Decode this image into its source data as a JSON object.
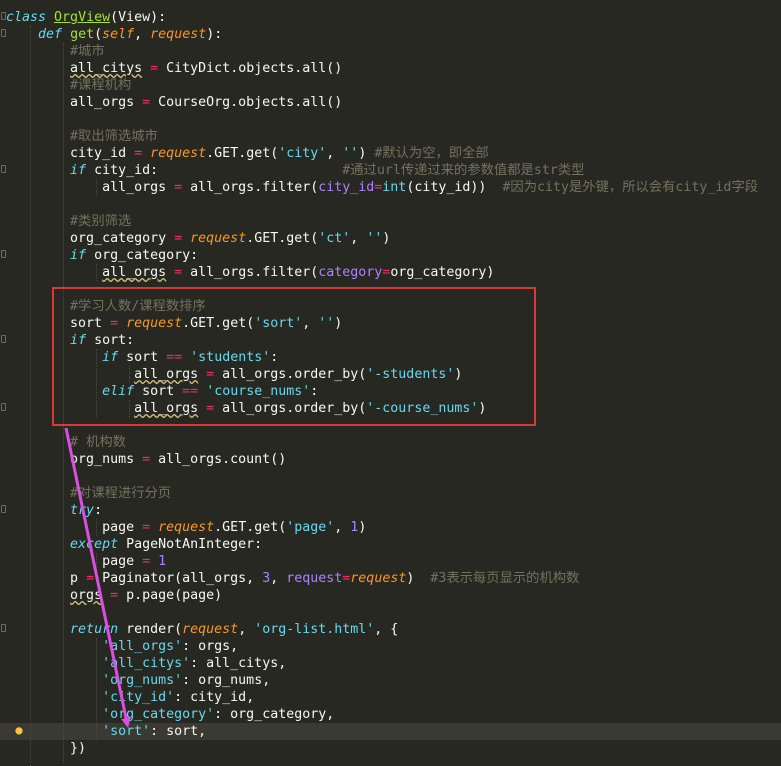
{
  "editor": {
    "lines": [
      [
        [
          "kw",
          "class"
        ],
        [
          "",
          " "
        ],
        [
          "cls",
          "OrgView"
        ],
        [
          "",
          "(View):"
        ]
      ],
      [
        [
          "",
          "    "
        ],
        [
          "kw",
          "def"
        ],
        [
          "",
          " "
        ],
        [
          "fn",
          "get"
        ],
        [
          "",
          "("
        ],
        [
          "self",
          "self"
        ],
        [
          "",
          ", "
        ],
        [
          "param",
          "request"
        ],
        [
          "",
          "):"
        ]
      ],
      [
        [
          "",
          "        "
        ],
        [
          "com",
          "#城市"
        ]
      ],
      [
        [
          "",
          "        "
        ],
        [
          "warn",
          "all_citys"
        ],
        [
          "",
          " "
        ],
        [
          "op",
          "="
        ],
        [
          "",
          " CityDict.objects.all()"
        ]
      ],
      [
        [
          "",
          "        "
        ],
        [
          "com",
          "#课程机构"
        ]
      ],
      [
        [
          "",
          "        all_orgs "
        ],
        [
          "op",
          "="
        ],
        [
          "",
          " CourseOrg.objects.all()"
        ]
      ],
      [],
      [
        [
          "",
          "        "
        ],
        [
          "com",
          "#取出筛选城市"
        ]
      ],
      [
        [
          "",
          "        city_id "
        ],
        [
          "op",
          "="
        ],
        [
          "",
          " "
        ],
        [
          "param",
          "request"
        ],
        [
          "",
          ".GET.get("
        ],
        [
          "str",
          "'city'"
        ],
        [
          "",
          ", "
        ],
        [
          "str",
          "''"
        ],
        [
          "",
          ") "
        ],
        [
          "com",
          "#默认为空，即全部"
        ]
      ],
      [
        [
          "",
          "        "
        ],
        [
          "kw",
          "if"
        ],
        [
          "",
          " city_id:                       "
        ],
        [
          "com",
          "#通过url传递过来的参数值都是str类型"
        ]
      ],
      [
        [
          "",
          "            all_orgs "
        ],
        [
          "op",
          "="
        ],
        [
          "",
          " all_orgs.filter("
        ],
        [
          "kwarg",
          "city_id"
        ],
        [
          "op",
          "="
        ],
        [
          "builtin",
          "int"
        ],
        [
          "",
          "(city_id))  "
        ],
        [
          "com",
          "#因为city是外键，所以会有city_id字段"
        ]
      ],
      [],
      [
        [
          "",
          "        "
        ],
        [
          "com",
          "#类别筛选"
        ]
      ],
      [
        [
          "",
          "        org_category "
        ],
        [
          "op",
          "="
        ],
        [
          "",
          " "
        ],
        [
          "param",
          "request"
        ],
        [
          "",
          ".GET.get("
        ],
        [
          "str",
          "'ct'"
        ],
        [
          "",
          ", "
        ],
        [
          "str",
          "''"
        ],
        [
          "",
          ")"
        ]
      ],
      [
        [
          "",
          "        "
        ],
        [
          "kw",
          "if"
        ],
        [
          "",
          " org_category:"
        ]
      ],
      [
        [
          "",
          "            "
        ],
        [
          "warn",
          "all_orgs"
        ],
        [
          "",
          " "
        ],
        [
          "op",
          "="
        ],
        [
          "",
          " all_orgs.filter("
        ],
        [
          "kwarg",
          "category"
        ],
        [
          "op",
          "="
        ],
        [
          "",
          "org_category)"
        ]
      ],
      [],
      [
        [
          "",
          "        "
        ],
        [
          "com",
          "#学习人数/课程数排序"
        ]
      ],
      [
        [
          "",
          "        sort "
        ],
        [
          "op",
          "="
        ],
        [
          "",
          " "
        ],
        [
          "param",
          "request"
        ],
        [
          "",
          ".GET.get("
        ],
        [
          "str",
          "'sort'"
        ],
        [
          "",
          ", "
        ],
        [
          "str",
          "''"
        ],
        [
          "",
          ")"
        ]
      ],
      [
        [
          "",
          "        "
        ],
        [
          "kw",
          "if"
        ],
        [
          "",
          " sort:"
        ]
      ],
      [
        [
          "",
          "            "
        ],
        [
          "kw",
          "if"
        ],
        [
          "",
          " sort "
        ],
        [
          "op",
          "=="
        ],
        [
          "",
          " "
        ],
        [
          "str",
          "'students'"
        ],
        [
          "",
          ":"
        ]
      ],
      [
        [
          "",
          "                "
        ],
        [
          "warn",
          "all_orgs"
        ],
        [
          "",
          " "
        ],
        [
          "op",
          "="
        ],
        [
          "",
          " all_orgs.order_by("
        ],
        [
          "str",
          "'-students'"
        ],
        [
          "",
          ")"
        ]
      ],
      [
        [
          "",
          "            "
        ],
        [
          "kw",
          "elif"
        ],
        [
          "",
          " sort "
        ],
        [
          "op",
          "=="
        ],
        [
          "",
          " "
        ],
        [
          "str",
          "'course_nums'"
        ],
        [
          "",
          ":"
        ]
      ],
      [
        [
          "",
          "                "
        ],
        [
          "warn",
          "all_orgs"
        ],
        [
          "",
          " "
        ],
        [
          "op",
          "="
        ],
        [
          "",
          " all_orgs.order_by("
        ],
        [
          "str",
          "'-course_nums'"
        ],
        [
          "",
          ")"
        ]
      ],
      [],
      [
        [
          "",
          "        "
        ],
        [
          "com",
          "# 机构数"
        ]
      ],
      [
        [
          "",
          "        org_nums "
        ],
        [
          "op",
          "="
        ],
        [
          "",
          " all_orgs.count()"
        ]
      ],
      [],
      [
        [
          "",
          "        "
        ],
        [
          "com",
          "#对课程进行分页"
        ]
      ],
      [
        [
          "",
          "        "
        ],
        [
          "kw",
          "try"
        ],
        [
          "",
          ":"
        ]
      ],
      [
        [
          "",
          "            page "
        ],
        [
          "op",
          "="
        ],
        [
          "",
          " "
        ],
        [
          "param",
          "request"
        ],
        [
          "",
          ".GET.get("
        ],
        [
          "str",
          "'page'"
        ],
        [
          "",
          ", "
        ],
        [
          "num",
          "1"
        ],
        [
          "",
          ")"
        ]
      ],
      [
        [
          "",
          "        "
        ],
        [
          "kw",
          "except"
        ],
        [
          "",
          " PageNotAnInteger:"
        ]
      ],
      [
        [
          "",
          "            page "
        ],
        [
          "op",
          "="
        ],
        [
          "",
          " "
        ],
        [
          "num",
          "1"
        ]
      ],
      [
        [
          "",
          "        p "
        ],
        [
          "op",
          "="
        ],
        [
          "",
          " Paginator(all_orgs, "
        ],
        [
          "num",
          "3"
        ],
        [
          "",
          ", "
        ],
        [
          "kwarg",
          "request"
        ],
        [
          "op",
          "="
        ],
        [
          "param",
          "request"
        ],
        [
          "",
          ")  "
        ],
        [
          "com",
          "#3表示每页显示的机构数"
        ]
      ],
      [
        [
          "",
          "        "
        ],
        [
          "warn",
          "orgs"
        ],
        [
          "",
          " "
        ],
        [
          "op",
          "="
        ],
        [
          "",
          " p.page(page)"
        ]
      ],
      [],
      [
        [
          "",
          "        "
        ],
        [
          "kw",
          "return"
        ],
        [
          "",
          " render("
        ],
        [
          "param",
          "request"
        ],
        [
          "",
          ", "
        ],
        [
          "str",
          "'org-list.html'"
        ],
        [
          "",
          ", {"
        ]
      ],
      [
        [
          "",
          "            "
        ],
        [
          "str",
          "'all_orgs'"
        ],
        [
          "",
          ": orgs,"
        ]
      ],
      [
        [
          "",
          "            "
        ],
        [
          "str",
          "'all_citys'"
        ],
        [
          "",
          ": all_citys,"
        ]
      ],
      [
        [
          "",
          "            "
        ],
        [
          "str",
          "'org_nums'"
        ],
        [
          "",
          ": org_nums,"
        ]
      ],
      [
        [
          "",
          "            "
        ],
        [
          "str",
          "'city_id'"
        ],
        [
          "",
          ": city_id,"
        ]
      ],
      [
        [
          "",
          "            "
        ],
        [
          "str",
          "'org_category'"
        ],
        [
          "",
          ": org_category,"
        ]
      ],
      [
        [
          "",
          "            "
        ],
        [
          "str",
          "'sort'"
        ],
        [
          "",
          ": sort,"
        ]
      ],
      [
        [
          "",
          "        })"
        ]
      ]
    ]
  },
  "annotation": {
    "box_color": "#d83a3a",
    "arrow_color": "#d94fe0"
  },
  "icons": {
    "gutter": "lightbulb-icon",
    "fold": "fold-marker-icon"
  }
}
